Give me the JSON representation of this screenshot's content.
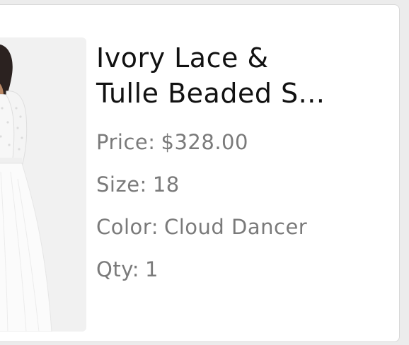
{
  "product": {
    "title_line1": "Ivory Lace &",
    "title_line2": "Tulle Beaded S...",
    "price_label": "Price:",
    "price_value": "$328.00",
    "size_label": "Size:",
    "size_value": "18",
    "color_label": "Color:",
    "color_value": "Cloud Dancer",
    "qty_label": "Qty:",
    "qty_value": "1"
  },
  "colors": {
    "title": "#111111",
    "meta": "#7a7a7a",
    "card_bg": "#ffffff",
    "thumb_bg": "#f1f1f1"
  }
}
